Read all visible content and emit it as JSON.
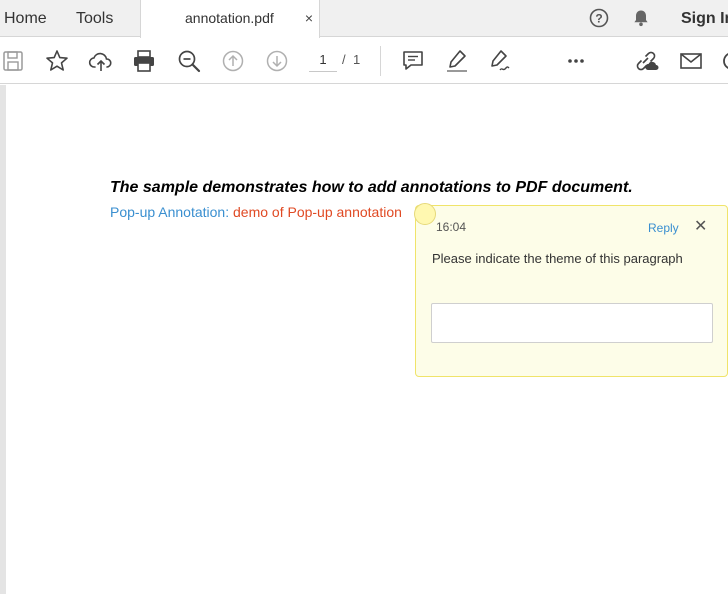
{
  "tabs": {
    "home": "Home",
    "tools": "Tools",
    "document": "annotation.pdf",
    "close": "×"
  },
  "header": {
    "sign_in": "Sign In",
    "icons": [
      "help-icon",
      "bell-icon"
    ]
  },
  "toolbar": {
    "icons": [
      "save-icon",
      "bookmark-star-icon",
      "upload-cloud-icon",
      "print-icon",
      "zoom-out-icon",
      "page-up-icon",
      "page-down-icon",
      "comment-icon",
      "highlight-pen-icon",
      "sign-pen-icon",
      "more-icon",
      "share-link-icon",
      "email-icon"
    ],
    "page_current": "1",
    "page_separator": "/",
    "page_total": "1"
  },
  "document": {
    "heading": "The sample demonstrates how to add annotations to PDF document.",
    "annotation_label": "Pop-up Annotation: ",
    "annotation_text": "demo of Pop-up annotation"
  },
  "popup": {
    "time": "16:04",
    "reply": "Reply",
    "close": "✕",
    "message": "Please indicate the theme of this paragraph",
    "reply_input_value": ""
  },
  "colors": {
    "annotation_label": "#3a8fd0",
    "annotation_text": "#e04a24",
    "popup_background": "#fdfde8",
    "popup_border": "#f0e46a"
  }
}
